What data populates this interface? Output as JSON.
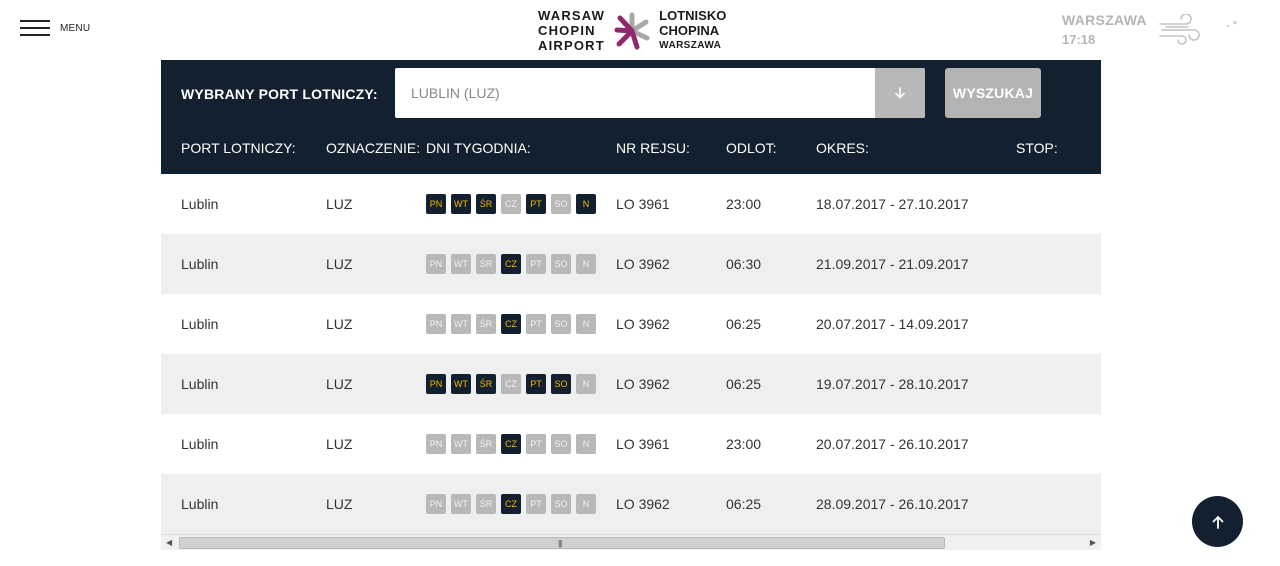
{
  "header": {
    "menu_label": "MENU",
    "logo_left": [
      "WARSAW",
      "CHOPIN",
      "AIRPORT"
    ],
    "logo_right": [
      "LOTNISKO",
      "CHOPINA",
      "WARSZAWA"
    ],
    "weather_city": "WARSZAWA",
    "weather_time": "17:18",
    "temperature": "- °"
  },
  "search": {
    "label": "WYBRANY PORT LOTNICZY:",
    "selected_port": "LUBLIN (LUZ)",
    "button_label": "WYSZUKAJ"
  },
  "columns": {
    "port": "PORT LOTNICZY:",
    "code": "OZNACZENIE:",
    "days": "DNI TYGODNIA:",
    "flight": "NR REJSU:",
    "departure": "ODLOT:",
    "period": "OKRES:",
    "stop": "STOP:"
  },
  "day_labels": [
    "PN",
    "WT",
    "ŚR",
    "CZ",
    "PT",
    "SO",
    "N"
  ],
  "rows": [
    {
      "port": "Lublin",
      "code": "LUZ",
      "days": [
        1,
        1,
        1,
        0,
        1,
        0,
        1
      ],
      "flight": "LO 3961",
      "departure": "23:00",
      "period": "18.07.2017 - 27.10.2017",
      "stop": ""
    },
    {
      "port": "Lublin",
      "code": "LUZ",
      "days": [
        0,
        0,
        0,
        1,
        0,
        0,
        0
      ],
      "flight": "LO 3962",
      "departure": "06:30",
      "period": "21.09.2017 - 21.09.2017",
      "stop": ""
    },
    {
      "port": "Lublin",
      "code": "LUZ",
      "days": [
        0,
        0,
        0,
        1,
        0,
        0,
        0
      ],
      "flight": "LO 3962",
      "departure": "06:25",
      "period": "20.07.2017 - 14.09.2017",
      "stop": ""
    },
    {
      "port": "Lublin",
      "code": "LUZ",
      "days": [
        1,
        1,
        1,
        0,
        1,
        1,
        0
      ],
      "flight": "LO 3962",
      "departure": "06:25",
      "period": "19.07.2017 - 28.10.2017",
      "stop": ""
    },
    {
      "port": "Lublin",
      "code": "LUZ",
      "days": [
        0,
        0,
        0,
        1,
        0,
        0,
        0
      ],
      "flight": "LO 3961",
      "departure": "23:00",
      "period": "20.07.2017 - 26.10.2017",
      "stop": ""
    },
    {
      "port": "Lublin",
      "code": "LUZ",
      "days": [
        0,
        0,
        0,
        1,
        0,
        0,
        0
      ],
      "flight": "LO 3962",
      "departure": "06:25",
      "period": "28.09.2017 - 26.10.2017",
      "stop": ""
    }
  ],
  "colors": {
    "panel": "#13202f",
    "day_active_text": "#f5b800",
    "day_inactive": "#b8b8b8",
    "row_alt": "#efefef",
    "logo_purple": "#8e2a6b",
    "logo_grey": "#a8a8a8"
  }
}
